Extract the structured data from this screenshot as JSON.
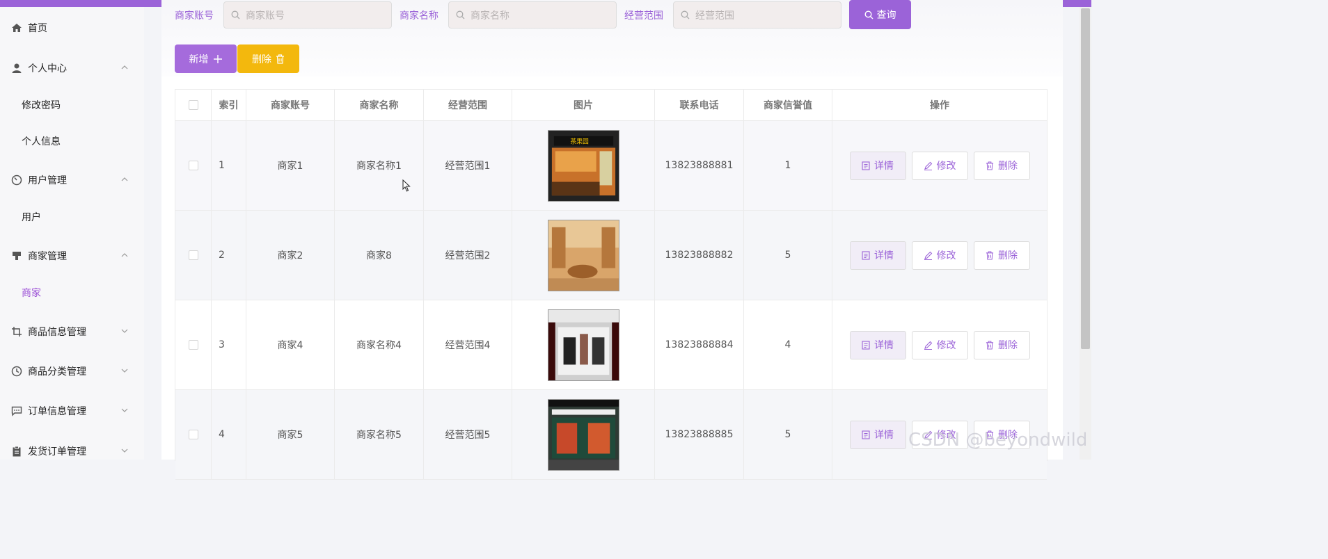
{
  "sidebar": {
    "items": [
      {
        "label": "首页",
        "icon": "home-icon"
      },
      {
        "label": "个人中心",
        "icon": "user-icon"
      },
      {
        "label": "修改密码"
      },
      {
        "label": "个人信息"
      },
      {
        "label": "用户管理",
        "icon": "gauge-icon"
      },
      {
        "label": "用户"
      },
      {
        "label": "商家管理",
        "icon": "shop-icon"
      },
      {
        "label": "商家"
      },
      {
        "label": "商品信息管理",
        "icon": "crop-icon"
      },
      {
        "label": "商品分类管理",
        "icon": "clock-icon"
      },
      {
        "label": "订单信息管理",
        "icon": "chat-icon"
      },
      {
        "label": "发货订单管理",
        "icon": "clipboard-icon"
      }
    ]
  },
  "search": {
    "fields": [
      {
        "label": "商家账号",
        "placeholder": "商家账号"
      },
      {
        "label": "商家名称",
        "placeholder": "商家名称"
      },
      {
        "label": "经营范围",
        "placeholder": "经营范围"
      }
    ],
    "query_label": "查询"
  },
  "toolbar": {
    "add_label": "新增",
    "delete_label": "删除"
  },
  "table": {
    "columns": [
      "索引",
      "商家账号",
      "商家名称",
      "经营范围",
      "图片",
      "联系电话",
      "商家信誉值",
      "操作"
    ],
    "rows": [
      {
        "index": "1",
        "account": "商家1",
        "name": "商家名称1",
        "scope": "经营范围1",
        "phone": "13823888881",
        "credit": "1"
      },
      {
        "index": "2",
        "account": "商家2",
        "name": "商家8",
        "scope": "经营范围2",
        "phone": "13823888882",
        "credit": "5"
      },
      {
        "index": "3",
        "account": "商家4",
        "name": "商家名称4",
        "scope": "经营范围4",
        "phone": "13823888884",
        "credit": "4"
      },
      {
        "index": "4",
        "account": "商家5",
        "name": "商家名称5",
        "scope": "经营范围5",
        "phone": "13823888885",
        "credit": "5"
      }
    ],
    "actions": {
      "detail": "详情",
      "edit": "修改",
      "delete": "删除"
    }
  },
  "watermark": "CSDN @beyondwild",
  "colors": {
    "accent": "#9b63d8",
    "warning": "#f3b80d",
    "active_menu": "#9b4fd6"
  }
}
